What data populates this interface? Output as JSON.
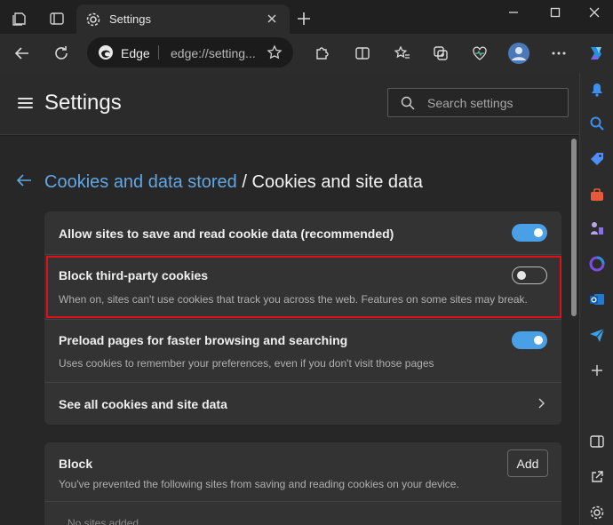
{
  "window": {
    "tab_title": "Settings",
    "minimize_label": "–"
  },
  "toolbar": {
    "brand": "Edge",
    "url": "edge://setting..."
  },
  "settings": {
    "title": "Settings",
    "search_placeholder": "Search settings"
  },
  "breadcrumb": {
    "parent": "Cookies and data stored",
    "separator": "/",
    "current": "Cookies and site data"
  },
  "rows": {
    "allow": {
      "title": "Allow sites to save and read cookie data (recommended)",
      "enabled": true
    },
    "block_third_party": {
      "title": "Block third-party cookies",
      "description": "When on, sites can't use cookies that track you across the web. Features on some sites may break.",
      "enabled": false
    },
    "preload": {
      "title": "Preload pages for faster browsing and searching",
      "description": "Uses cookies to remember your preferences, even if you don't visit those pages",
      "enabled": true
    },
    "see_all": {
      "title": "See all cookies and site data"
    }
  },
  "block_section": {
    "title": "Block",
    "description": "You've prevented the following sites from saving and reading cookies on your device.",
    "add_label": "Add",
    "empty_text": "No sites added"
  },
  "colors": {
    "accent": "#4aa0e6",
    "link": "#61a7e4",
    "highlight": "#e0101a"
  },
  "icons": {
    "workspaces": "workspaces-icon",
    "tab_actions": "tab-actions-icon",
    "gear": "gear-icon",
    "close": "close-icon",
    "new_tab": "plus-icon",
    "back": "back-arrow-icon",
    "refresh": "refresh-icon",
    "extensions": "puzzle-icon",
    "split": "split-screen-icon",
    "favorites": "favorites-icon",
    "collections": "collections-icon",
    "health": "browser-essentials-icon",
    "profile": "profile-avatar-icon",
    "more": "more-icon",
    "copilot": "copilot-icon",
    "search": "search-icon"
  }
}
